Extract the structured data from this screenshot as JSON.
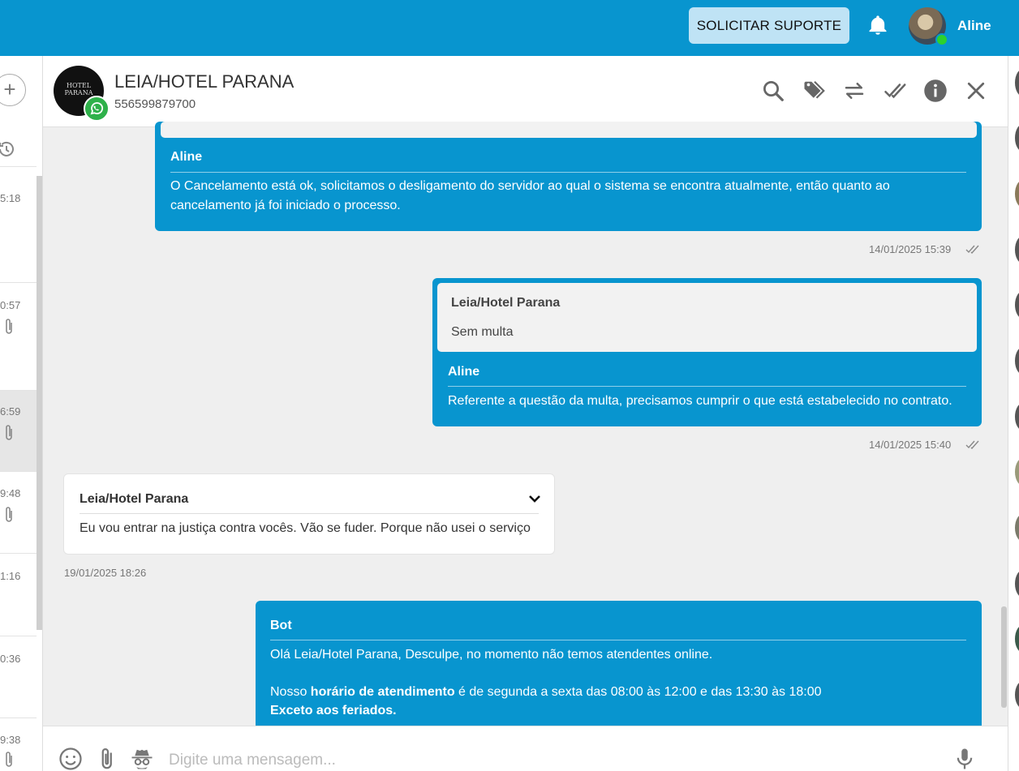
{
  "topbar": {
    "support_button": "SOLICITAR SUPORTE",
    "user_name": "Aline"
  },
  "sidebar": {
    "conversations": [
      {
        "time": "5:18",
        "attachment": false
      },
      {
        "time": "0:57",
        "attachment": true
      },
      {
        "time": "6:59",
        "attachment": true,
        "active": true
      },
      {
        "time": "9:48",
        "attachment": true
      },
      {
        "time": "1:16",
        "attachment": false
      },
      {
        "time": "0:36",
        "attachment": false
      },
      {
        "time": "9:38",
        "attachment": true
      }
    ]
  },
  "chat_header": {
    "contact_name": "LEIA/HOTEL PARANA",
    "contact_phone": "556599879700",
    "avatar_text_line1": "HOTEL",
    "avatar_text_line2": "PARANA"
  },
  "messages": [
    {
      "direction": "out",
      "sender": "Aline",
      "body_line1": "O Cancelamento está ok, solicitamos o desligamento do servidor ao qual o sistema se encontra atualmente, então quanto ao",
      "body_line2": "cancelamento já foi iniciado o processo.",
      "timestamp": "14/01/2025 15:39"
    },
    {
      "direction": "out",
      "quote_sender": "Leia/Hotel Parana",
      "quote_text": "Sem multa",
      "sender": "Aline",
      "body": "Referente a questão da multa, precisamos cumprir o que está estabelecido no contrato.",
      "timestamp": "14/01/2025 15:40"
    },
    {
      "direction": "in",
      "sender": "Leia/Hotel Parana",
      "body": "Eu vou entrar na justiça contra vocês. Vão se fuder. Porque não usei o serviço",
      "timestamp": "19/01/2025 18:26"
    },
    {
      "direction": "out",
      "sender": "Bot",
      "body_line1": "Olá Leia/Hotel Parana, Desculpe, no momento não temos atendentes online.",
      "body_line2_prefix": "Nosso ",
      "body_line2_bold": "horário de atendimento",
      "body_line2_suffix": " é de segunda a sexta das 08:00 às 12:00 e das 13:30 às 18:00",
      "body_line3_bold": "Exceto aos feriados."
    }
  ],
  "composer": {
    "placeholder": "Digite uma mensagem..."
  },
  "colors": {
    "brand": "#0895cf",
    "online": "#2cd12c",
    "whatsapp": "#2fb14a"
  }
}
